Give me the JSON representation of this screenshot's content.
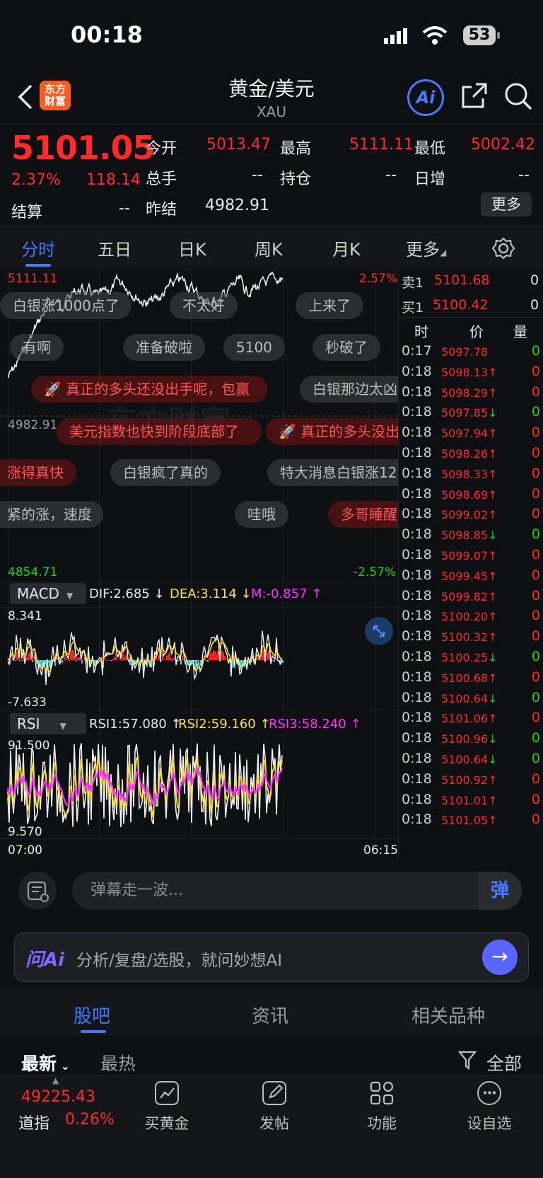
{
  "status_bar": {
    "time": "00:18",
    "battery": "53"
  },
  "header": {
    "logo_text": "东方财富",
    "title": "黄金/美元",
    "subtitle": "XAU",
    "ai_label": "Ai"
  },
  "quote": {
    "price": "5101.05",
    "change_pct": "2.37%",
    "change": "118.14",
    "settle_label": "结算",
    "settle_value": "--",
    "open_label": "今开",
    "open_value": "5013.47",
    "high_label": "最高",
    "high_value": "5111.11",
    "low_label": "最低",
    "low_value": "5002.42",
    "volume_label": "总手",
    "volume_value": "--",
    "position_label": "持仓",
    "position_value": "--",
    "daily_inc_label": "日增",
    "daily_inc_value": "--",
    "prev_settle_label": "昨结",
    "prev_settle_value": "4982.91",
    "more_button": "更多"
  },
  "chart_tabs": [
    "分时",
    "五日",
    "日K",
    "周K",
    "月K",
    "更多"
  ],
  "intraday": {
    "y_max": "5111.11",
    "y_max_pct": "2.57%",
    "y_mid": "4982.91",
    "y_min": "4854.71",
    "y_min_pct": "-2.57%",
    "x_start": "07:00",
    "x_end": "06:15",
    "watermark": "东方财富"
  },
  "danmu": [
    "白银涨1000点了",
    "不太好",
    "上来了",
    "有啊",
    "准备破啦",
    "5100",
    "秒破了",
    "真正的多头还没出手呢，包赢",
    "白银那边太凶",
    "美元指数也快到阶段底部了",
    "真正的多头没出手",
    "涨得真快",
    "白银疯了真的",
    "特大消息白银涨12",
    "紧的涨，速度",
    "哇哦",
    "多哥睡醒"
  ],
  "macd": {
    "selector": "MACD",
    "dif": "DIF:2.685 ↓",
    "dea": "DEA:3.114 ↓",
    "m": "M:-0.857 ↑",
    "y_max": "8.341",
    "y_min": "-7.633"
  },
  "rsi": {
    "selector": "RSI",
    "rsi1": "RSI1:57.080 ↑",
    "rsi2": "RSI2:59.160 ↑",
    "rsi3": "RSI3:58.240 ↑",
    "y_max": "91.500",
    "y_min": "9.570"
  },
  "order_book": {
    "sell_label": "卖1",
    "sell_price": "5101.68",
    "sell_vol": "0",
    "buy_label": "买1",
    "buy_price": "5100.42",
    "buy_vol": "0"
  },
  "trades_header": {
    "time": "时",
    "price": "价",
    "volume": "量"
  },
  "trades": [
    {
      "time": "0:17",
      "price": "5097.78",
      "dir": "",
      "vol": "0",
      "up": true
    },
    {
      "time": "0:18",
      "price": "5098.13",
      "dir": "↑",
      "vol": "0",
      "up": true
    },
    {
      "time": "0:18",
      "price": "5098.29",
      "dir": "↑",
      "vol": "0",
      "up": true
    },
    {
      "time": "0:18",
      "price": "5097.85",
      "dir": "↓",
      "vol": "0",
      "up": false
    },
    {
      "time": "0:18",
      "price": "5097.94",
      "dir": "↑",
      "vol": "0",
      "up": true
    },
    {
      "time": "0:18",
      "price": "5098.26",
      "dir": "↑",
      "vol": "0",
      "up": true
    },
    {
      "time": "0:18",
      "price": "5098.33",
      "dir": "↑",
      "vol": "0",
      "up": true
    },
    {
      "time": "0:18",
      "price": "5098.69",
      "dir": "↑",
      "vol": "0",
      "up": true
    },
    {
      "time": "0:18",
      "price": "5099.02",
      "dir": "↑",
      "vol": "0",
      "up": true
    },
    {
      "time": "0:18",
      "price": "5098.85",
      "dir": "↓",
      "vol": "0",
      "up": false
    },
    {
      "time": "0:18",
      "price": "5099.07",
      "dir": "↑",
      "vol": "0",
      "up": true
    },
    {
      "time": "0:18",
      "price": "5099.45",
      "dir": "↑",
      "vol": "0",
      "up": true
    },
    {
      "time": "0:18",
      "price": "5099.82",
      "dir": "↑",
      "vol": "0",
      "up": true
    },
    {
      "time": "0:18",
      "price": "5100.20",
      "dir": "↑",
      "vol": "0",
      "up": true
    },
    {
      "time": "0:18",
      "price": "5100.32",
      "dir": "↑",
      "vol": "0",
      "up": true
    },
    {
      "time": "0:18",
      "price": "5100.25",
      "dir": "↓",
      "vol": "0",
      "up": false
    },
    {
      "time": "0:18",
      "price": "5100.68",
      "dir": "↑",
      "vol": "0",
      "up": true
    },
    {
      "time": "0:18",
      "price": "5100.64",
      "dir": "↓",
      "vol": "0",
      "up": false
    },
    {
      "time": "0:18",
      "price": "5101.06",
      "dir": "↑",
      "vol": "0",
      "up": true
    },
    {
      "time": "0:18",
      "price": "5100.96",
      "dir": "↓",
      "vol": "0",
      "up": false
    },
    {
      "time": "0:18",
      "price": "5100.64",
      "dir": "↓",
      "vol": "0",
      "up": false
    },
    {
      "time": "0:18",
      "price": "5100.92",
      "dir": "↑",
      "vol": "0",
      "up": true
    },
    {
      "time": "0:18",
      "price": "5101.01",
      "dir": "↑",
      "vol": "0",
      "up": true
    },
    {
      "time": "0:18",
      "price": "5101.05",
      "dir": "↑",
      "vol": "0",
      "up": true
    }
  ],
  "danmu_bar": {
    "placeholder": "弹幕走一波...",
    "send_label": "弹"
  },
  "ai_bar": {
    "label": "问Ai",
    "placeholder": "分析/复盘/选股，就问妙想AI"
  },
  "section_tabs": [
    "股吧",
    "资讯",
    "相关品种"
  ],
  "filter": {
    "latest": "最新",
    "hot": "最热",
    "all": "全部"
  },
  "bottom_nav": {
    "index_value": "49225.43",
    "index_name": "道指",
    "index_change": "0.26%",
    "items": [
      "买黄金",
      "发帖",
      "功能",
      "设自选"
    ]
  },
  "colors": {
    "up": "#ff2a2a",
    "down": "#1fd11f",
    "accent": "#3e7bff"
  },
  "icons": [
    "back-chevron-icon",
    "share-icon",
    "search-icon",
    "settings-gear-icon",
    "expand-icon",
    "danmu-settings-icon",
    "arrow-right-icon",
    "filter-icon",
    "chart-icon",
    "edit-icon",
    "grid-icon",
    "more-dots-icon"
  ]
}
